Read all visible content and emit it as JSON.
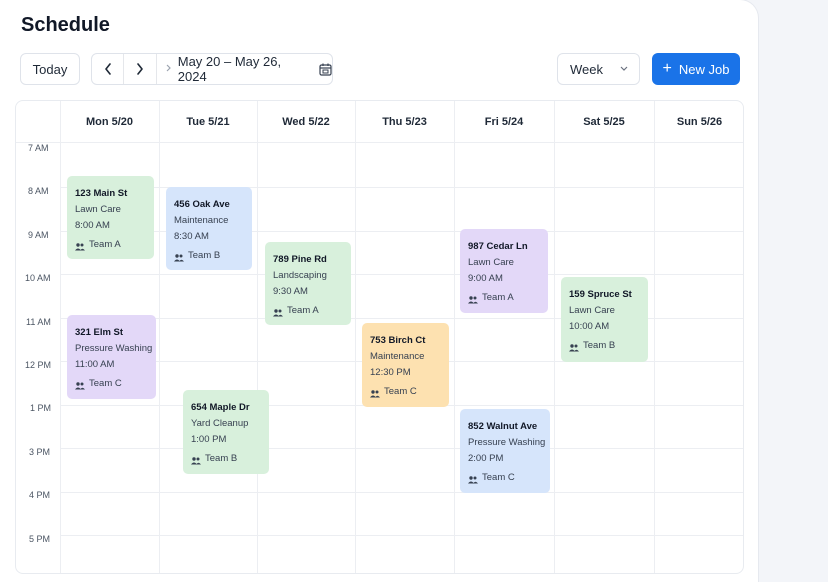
{
  "header": {
    "title": "Schedule"
  },
  "toolbar": {
    "today_label": "Today",
    "prev_icon": "chevron-left-icon",
    "next_icon": "chevron-right-icon",
    "date_range": "May 20 – May 26, 2024",
    "view_value": "Week",
    "new_job_label": "New Job"
  },
  "days": [
    "Mon 5/20",
    "Tue 5/21",
    "Wed 5/22",
    "Thu 5/23",
    "Fri 5/24",
    "Sat 5/25",
    "Sun 5/26"
  ],
  "times": [
    "7 AM",
    "8 AM",
    "9 AM",
    "10 AM",
    "11 AM",
    "12 PM",
    "1 PM",
    "3 PM",
    "4 PM",
    "5 PM"
  ],
  "events": [
    {
      "address": "123 Main St",
      "service": "Lawn Care",
      "time": "8:00 AM",
      "team": "Team A",
      "color": "#d8f0dc"
    },
    {
      "address": "456 Oak Ave",
      "service": "Maintenance",
      "time": "8:30 AM",
      "team": "Team B",
      "color": "#d6e5fb"
    },
    {
      "address": "789 Pine Rd",
      "service": "Landscaping",
      "time": "9:30 AM",
      "team": "Team A",
      "color": "#d8f0dc"
    },
    {
      "address": "987 Cedar Ln",
      "service": "Lawn Care",
      "time": "9:00 AM",
      "team": "Team A",
      "color": "#e3d8f8"
    },
    {
      "address": "159 Spruce St",
      "service": "Lawn Care",
      "time": "10:00 AM",
      "team": "Team B",
      "color": "#d8f0dc"
    },
    {
      "address": "321 Elm St",
      "service": "Pressure Washing",
      "time": "11:00 AM",
      "team": "Team C",
      "color": "#e3d8f8"
    },
    {
      "address": "753 Birch Ct",
      "service": "Maintenance",
      "time": "12:30 PM",
      "team": "Team C",
      "color": "#fde1b0"
    },
    {
      "address": "654 Maple Dr",
      "service": "Yard Cleanup",
      "time": "1:00 PM",
      "team": "Team B",
      "color": "#d8f0dc"
    },
    {
      "address": "852 Walnut Ave",
      "service": "Pressure Washing",
      "time": "2:00 PM",
      "team": "Team C",
      "color": "#d6e5fb"
    }
  ]
}
